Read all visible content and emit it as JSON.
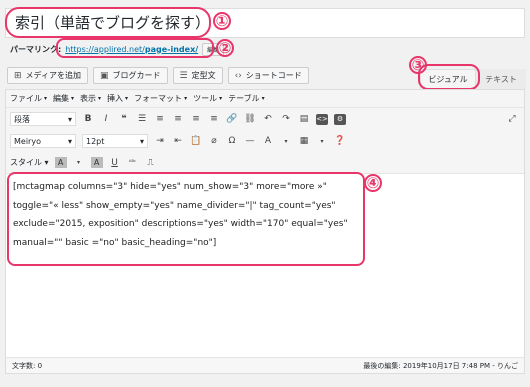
{
  "title": {
    "value": "索引（単語でブログを探す）"
  },
  "permalink": {
    "label": "パーマリンク:",
    "url_prefix": "https://applired.net/",
    "url_slug": "page-index/",
    "edit_label": "編集"
  },
  "media_buttons": [
    {
      "label": "メディアを追加",
      "icon": "media-icon"
    },
    {
      "label": "ブログカード",
      "icon": "card-icon"
    },
    {
      "label": "定型文",
      "icon": "template-icon"
    },
    {
      "label": "ショートコード",
      "icon": "code-icon"
    }
  ],
  "tabs": {
    "visual": "ビジュアル",
    "text": "テキスト"
  },
  "menubar": [
    "ファイル",
    "編集",
    "表示",
    "挿入",
    "フォーマット",
    "ツール",
    "テーブル"
  ],
  "toolbar": {
    "format_select": "段落",
    "font_select": "Meiryo",
    "size_select": "12pt",
    "style_label": "スタイル"
  },
  "content_lines": [
    "[mctagmap columns=\"3\" hide=\"yes\" num_show=\"3\" more=\"more »\"",
    "toggle=\"« less\" show_empty=\"yes\" name_divider=\"|\" tag_count=\"yes\"",
    "exclude=\"2015, exposition\" descriptions=\"yes\" width=\"170\" equal=\"yes\"",
    "manual=\"\" basic =\"no\" basic_heading=\"no\"]"
  ],
  "status": {
    "word_count": "文字数: 0",
    "last_edit": "最後の編集: 2019年10月17日 7:48 PM - りんご"
  },
  "annotations": [
    "①",
    "②",
    "③",
    "④"
  ],
  "colors": {
    "annotation": "#e8356a",
    "link": "#0073aa"
  }
}
